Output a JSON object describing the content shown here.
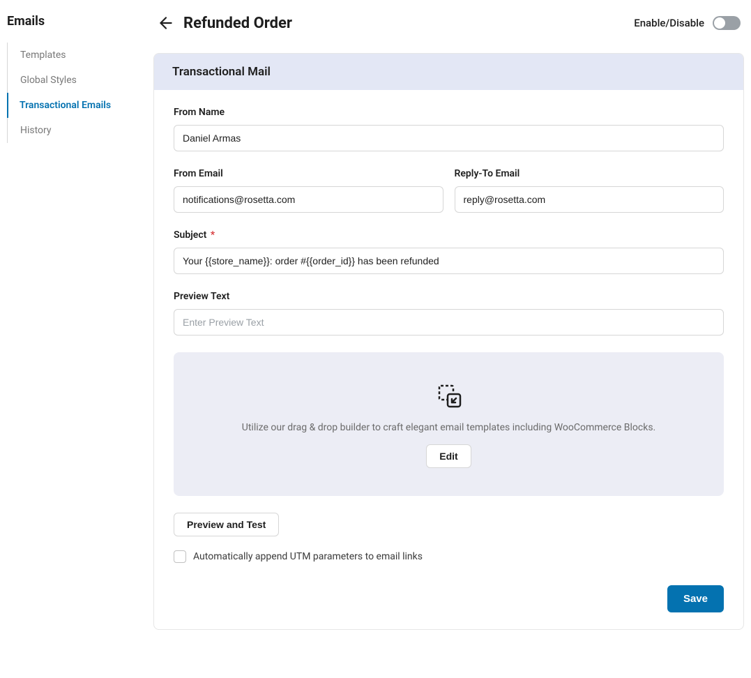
{
  "sidebar": {
    "title": "Emails",
    "items": [
      {
        "label": "Templates"
      },
      {
        "label": "Global Styles"
      },
      {
        "label": "Transactional Emails"
      },
      {
        "label": "History"
      }
    ]
  },
  "header": {
    "title": "Refunded Order",
    "toggle_label": "Enable/Disable"
  },
  "card": {
    "title": "Transactional Mail",
    "from_name_label": "From Name",
    "from_name_value": "Daniel Armas",
    "from_email_label": "From Email",
    "from_email_value": "notifications@rosetta.com",
    "reply_to_label": "Reply-To Email",
    "reply_to_value": "reply@rosetta.com",
    "subject_label": "Subject",
    "subject_value": "Your {{store_name}}: order #{{order_id}} has been refunded",
    "preview_label": "Preview Text",
    "preview_placeholder": "Enter Preview Text",
    "builder_text": "Utilize our drag & drop builder to craft elegant email templates including WooCommerce Blocks.",
    "edit_label": "Edit",
    "preview_test_label": "Preview and Test",
    "utm_label": "Automatically append UTM parameters to email links",
    "save_label": "Save"
  }
}
